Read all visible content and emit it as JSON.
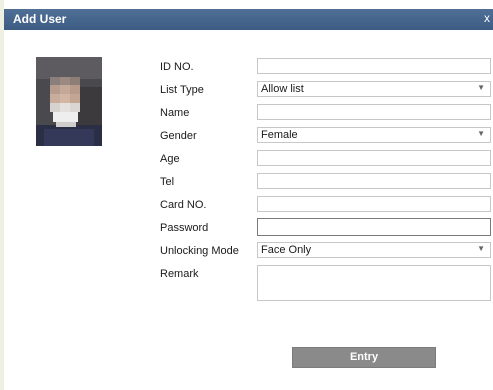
{
  "dialog": {
    "title": "Add User",
    "close_icon": "close-icon",
    "close_glyph": "x"
  },
  "photo": {
    "description_icon": "user-photo"
  },
  "form": {
    "id_no": {
      "label": "ID NO.",
      "value": ""
    },
    "list_type": {
      "label": "List Type",
      "value": "Allow list"
    },
    "name": {
      "label": "Name",
      "value": ""
    },
    "gender": {
      "label": "Gender",
      "value": "Female"
    },
    "age": {
      "label": "Age",
      "value": ""
    },
    "tel": {
      "label": "Tel",
      "value": ""
    },
    "card_no": {
      "label": "Card NO.",
      "value": ""
    },
    "password": {
      "label": "Password",
      "value": ""
    },
    "unlocking_mode": {
      "label": "Unlocking Mode",
      "value": "Face Only"
    },
    "remark": {
      "label": "Remark",
      "value": ""
    }
  },
  "entry_button": {
    "label": "Entry"
  },
  "colors": {
    "titlebar": "#4a6a93",
    "button": "#8a8a8a"
  }
}
